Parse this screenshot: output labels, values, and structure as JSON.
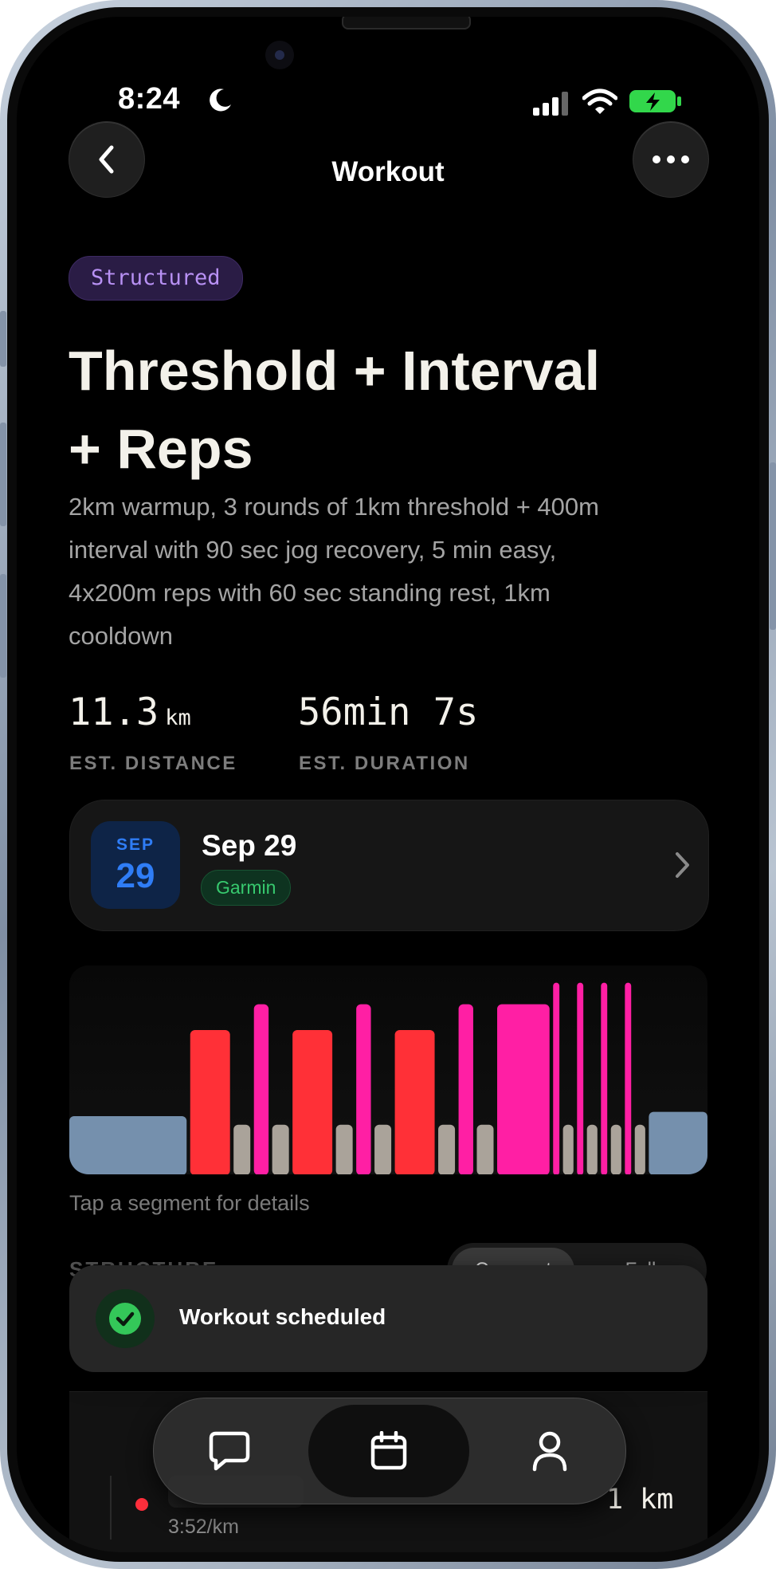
{
  "status_bar": {
    "time": "8:24"
  },
  "nav": {
    "title": "Workout"
  },
  "workout": {
    "badge": "Structured",
    "title_line1": "Threshold + Interval",
    "title_line2": "+ Reps",
    "description_lines": [
      "2km warmup, 3 rounds of 1km threshold + 400m",
      "interval with 90 sec jog recovery, 5 min easy,",
      "4x200m reps with 60 sec standing rest, 1km",
      "cooldown"
    ]
  },
  "stats": [
    {
      "value": "11.3",
      "unit": "km",
      "label": "EST. DISTANCE"
    },
    {
      "value": "56min 7s",
      "unit": "",
      "label": "EST. DURATION"
    }
  ],
  "schedule": {
    "month": "SEP",
    "day": "29",
    "title": "Sep 29",
    "provider": "Garmin"
  },
  "chart_data": {
    "type": "bar",
    "note_hint": "Tap a segment for details",
    "segments": [
      {
        "kind": "warmup",
        "duration": 28,
        "intensity": 1.0,
        "color": "#7590ad"
      },
      {
        "kind": "threshold",
        "duration": 9.5,
        "intensity": 3.0,
        "color": "#ff3037"
      },
      {
        "kind": "rest",
        "duration": 4,
        "intensity": 0.8,
        "color": "#aaa39a"
      },
      {
        "kind": "interval",
        "duration": 3.5,
        "intensity": 3.6,
        "color": "#ff1fa4"
      },
      {
        "kind": "rest",
        "duration": 4,
        "intensity": 0.8,
        "color": "#aaa39a"
      },
      {
        "kind": "threshold",
        "duration": 9.5,
        "intensity": 3.0,
        "color": "#ff3037"
      },
      {
        "kind": "rest",
        "duration": 4,
        "intensity": 0.8,
        "color": "#aaa39a"
      },
      {
        "kind": "interval",
        "duration": 3.5,
        "intensity": 3.6,
        "color": "#ff1fa4"
      },
      {
        "kind": "rest",
        "duration": 4,
        "intensity": 0.8,
        "color": "#aaa39a"
      },
      {
        "kind": "threshold",
        "duration": 9.5,
        "intensity": 3.0,
        "color": "#ff3037"
      },
      {
        "kind": "rest",
        "duration": 4,
        "intensity": 0.8,
        "color": "#aaa39a"
      },
      {
        "kind": "interval",
        "duration": 3.5,
        "intensity": 3.6,
        "color": "#ff1fa4"
      },
      {
        "kind": "rest",
        "duration": 4,
        "intensity": 0.8,
        "color": "#aaa39a"
      },
      {
        "kind": "easy",
        "duration": 12.5,
        "intensity": 3.6,
        "color": "#ff1fa4"
      },
      {
        "kind": "rep",
        "duration": 1.5,
        "intensity": 4.1,
        "color": "#ff1fa4"
      },
      {
        "kind": "rest",
        "duration": 2.5,
        "intensity": 0.8,
        "color": "#aaa39a"
      },
      {
        "kind": "rep",
        "duration": 1.5,
        "intensity": 4.1,
        "color": "#ff1fa4"
      },
      {
        "kind": "rest",
        "duration": 2.5,
        "intensity": 0.8,
        "color": "#aaa39a"
      },
      {
        "kind": "rep",
        "duration": 1.5,
        "intensity": 4.1,
        "color": "#ff1fa4"
      },
      {
        "kind": "rest",
        "duration": 2.5,
        "intensity": 0.8,
        "color": "#aaa39a"
      },
      {
        "kind": "rep",
        "duration": 1.5,
        "intensity": 4.1,
        "color": "#ff1fa4"
      },
      {
        "kind": "rest",
        "duration": 2.5,
        "intensity": 0.8,
        "color": "#aaa39a"
      },
      {
        "kind": "cooldown",
        "duration": 14,
        "intensity": 1.1,
        "color": "#7590ad"
      }
    ]
  },
  "structure": {
    "label": "STRUCTURE",
    "toggle_left": "Compact",
    "toggle_right": "Full",
    "first_step_distance": "1 km",
    "first_step_pace": "3:52/km"
  },
  "toast": {
    "message": "Workout scheduled"
  },
  "tabbar": {
    "items": [
      {
        "name": "chat",
        "icon": "chat-bubble-icon"
      },
      {
        "name": "calendar",
        "icon": "calendar-icon",
        "active": true
      },
      {
        "name": "profile",
        "icon": "person-icon"
      }
    ]
  },
  "colors": {
    "background": "#000000",
    "badge_purple": "#b891f4",
    "garmin_green": "#37c96e",
    "date_blue": "#2f7df6",
    "toast_check": "#34c759"
  }
}
